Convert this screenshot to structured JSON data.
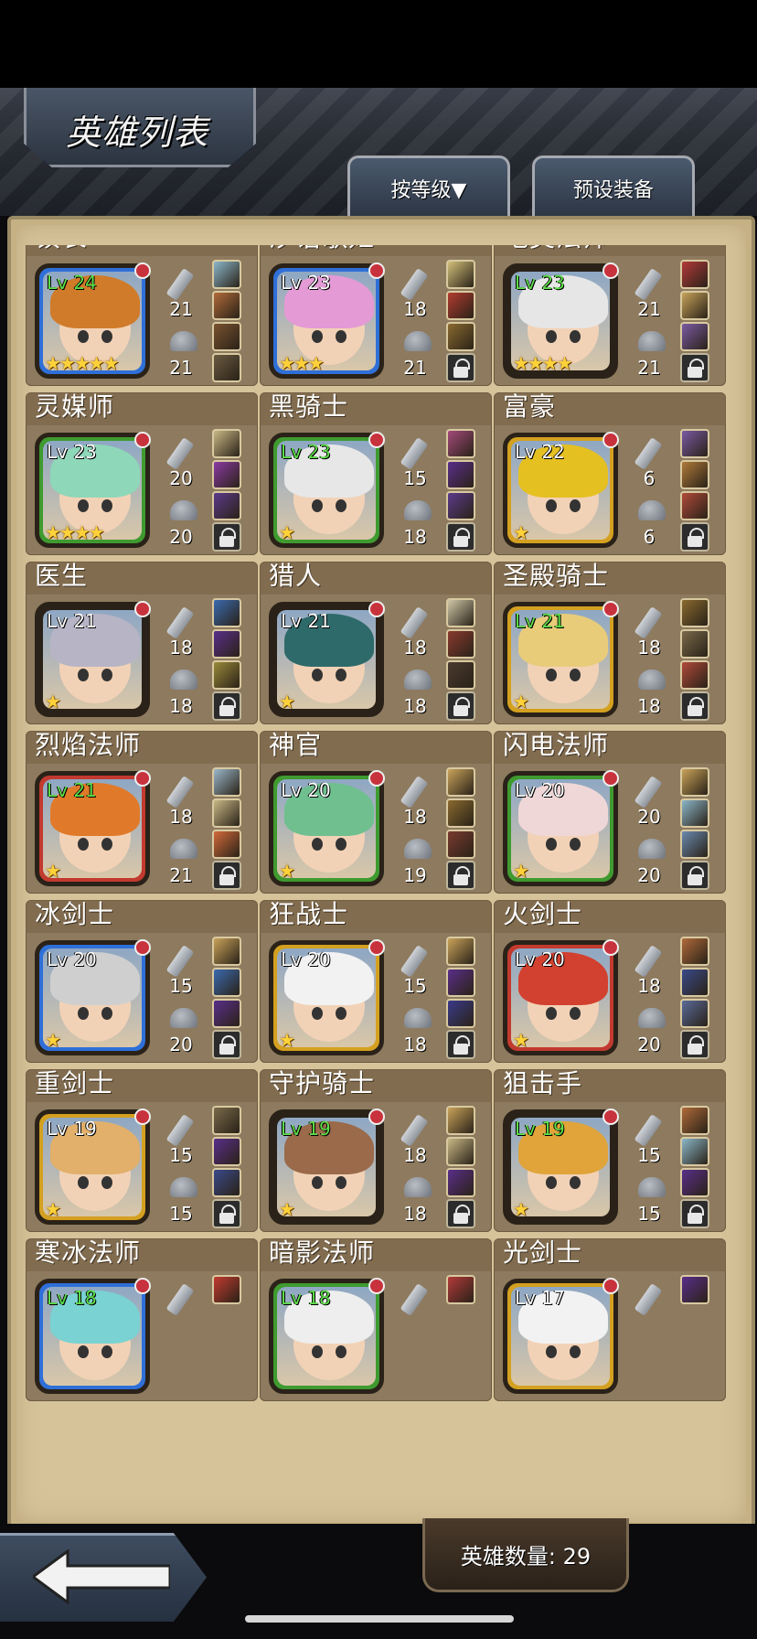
{
  "header": {
    "title": "英雄列表",
    "sort_label": "按等级▼",
    "preset_label": "预设装备"
  },
  "footer": {
    "hero_count": "英雄数量: 29"
  },
  "heroes": [
    {
      "name": "镇长",
      "lv": "Lv 24",
      "lv_green": true,
      "frame": "#2f6fd8",
      "hair": "#d07b2a",
      "stars": "★★★★★",
      "atk": "21",
      "def": "21",
      "slots": [
        "#8bb7c9",
        "#b06a3a",
        "#7a5230",
        "#6a5a40"
      ],
      "lock": false
    },
    {
      "name": "汐语歌姬",
      "lv": "Lv 23",
      "lv_green": false,
      "frame": "#2f6fd8",
      "hair": "#e39ad5",
      "stars": "★★★",
      "atk": "18",
      "def": "21",
      "slots": [
        "#d2c07a",
        "#b23b2f",
        "#8a6a2f"
      ],
      "lock": true
    },
    {
      "name": "地灵法师",
      "lv": "Lv 23",
      "lv_green": true,
      "frame": "#2a2218",
      "hair": "#e6e6e6",
      "stars": "★★★★",
      "atk": "21",
      "def": "21",
      "slots": [
        "#b33a3a",
        "#c7a35a",
        "#7a5aa3"
      ],
      "lock": true
    },
    {
      "name": "灵媒师",
      "lv": "Lv 23",
      "lv_green": false,
      "frame": "#3f9a2f",
      "hair": "#8ed7b9",
      "stars": "★★★★",
      "atk": "20",
      "def": "20",
      "slots": [
        "#c9b886",
        "#8a3aa3",
        "#5b3a8a"
      ],
      "lock": true
    },
    {
      "name": "黑骑士",
      "lv": "Lv 23",
      "lv_green": true,
      "frame": "#3f9a2f",
      "hair": "#e7e7e7",
      "stars": "★",
      "atk": "15",
      "def": "18",
      "slots": [
        "#a34a7a",
        "#5a2e8a",
        "#5b3a8a"
      ],
      "lock": true
    },
    {
      "name": "富豪",
      "lv": "Lv 22",
      "lv_green": false,
      "frame": "#d4a020",
      "hair": "#e5c021",
      "stars": "★",
      "atk": "6",
      "def": "6",
      "slots": [
        "#7a5aa3",
        "#b07a3a",
        "#b04a3a"
      ],
      "lock": true
    },
    {
      "name": "医生",
      "lv": "Lv 21",
      "lv_green": false,
      "frame": "#2a2218",
      "hair": "#b7b4c6",
      "stars": "★",
      "atk": "18",
      "def": "18",
      "slots": [
        "#3a6ab0",
        "#5a2e8a",
        "#9a8a3a"
      ],
      "lock": true
    },
    {
      "name": "猎人",
      "lv": "Lv 21",
      "lv_green": false,
      "frame": "#2a2218",
      "hair": "#2f6a6a",
      "stars": "★",
      "atk": "18",
      "def": "18",
      "slots": [
        "#d0c7a8",
        "#8a3a2f",
        "#4a3a2f"
      ],
      "lock": true
    },
    {
      "name": "圣殿骑士",
      "lv": "Lv 21",
      "lv_green": true,
      "frame": "#d4a020",
      "hair": "#e8cc7a",
      "stars": "★",
      "atk": "18",
      "def": "18",
      "slots": [
        "#8a6a2f",
        "#7a6a4a",
        "#b04a3a"
      ],
      "lock": true
    },
    {
      "name": "烈焰法师",
      "lv": "Lv 21",
      "lv_green": true,
      "frame": "#c23a2f",
      "hair": "#e07a2a",
      "stars": "★",
      "atk": "18",
      "def": "21",
      "slots": [
        "#9ab7c9",
        "#c9b886",
        "#d26a3a"
      ],
      "lock": true
    },
    {
      "name": "神官",
      "lv": "Lv 20",
      "lv_green": false,
      "frame": "#3f9a2f",
      "hair": "#6fbf8f",
      "stars": "★",
      "atk": "18",
      "def": "19",
      "slots": [
        "#c9a35a",
        "#8a6a2f",
        "#7a3a2f"
      ],
      "lock": true
    },
    {
      "name": "闪电法师",
      "lv": "Lv 20",
      "lv_green": false,
      "frame": "#3f9a2f",
      "hair": "#f0d7d7",
      "stars": "★",
      "atk": "20",
      "def": "20",
      "slots": [
        "#c9a35a",
        "#8bb7c9",
        "#6a8ab0"
      ],
      "lock": true
    },
    {
      "name": "冰剑士",
      "lv": "Lv 20",
      "lv_green": false,
      "frame": "#2f6fd8",
      "hair": "#cfcfcf",
      "stars": "★",
      "atk": "15",
      "def": "20",
      "slots": [
        "#c9a35a",
        "#3a6ab0",
        "#5a2e8a"
      ],
      "lock": true
    },
    {
      "name": "狂战士",
      "lv": "Lv 20",
      "lv_green": false,
      "frame": "#d4a020",
      "hair": "#f2f2f2",
      "stars": "★",
      "atk": "15",
      "def": "18",
      "slots": [
        "#c9a35a",
        "#5a2e8a",
        "#3a3a8a"
      ],
      "lock": true
    },
    {
      "name": "火剑士",
      "lv": "Lv 20",
      "lv_green": false,
      "frame": "#c23a2f",
      "hair": "#d2402f",
      "stars": "★",
      "atk": "18",
      "def": "20",
      "slots": [
        "#b06a3a",
        "#3a4a8a",
        "#5a6a9a"
      ],
      "lock": true
    },
    {
      "name": "重剑士",
      "lv": "Lv 19",
      "lv_green": false,
      "frame": "#d4a020",
      "hair": "#e2b06a",
      "stars": "★",
      "atk": "15",
      "def": "15",
      "slots": [
        "#7a6a4a",
        "#5a2e8a",
        "#3a4a8a"
      ],
      "lock": true
    },
    {
      "name": "守护骑士",
      "lv": "Lv 19",
      "lv_green": true,
      "frame": "#2a2218",
      "hair": "#9a6a4a",
      "stars": "★",
      "atk": "18",
      "def": "18",
      "slots": [
        "#c9a35a",
        "#c9b886",
        "#5a2e8a"
      ],
      "lock": true
    },
    {
      "name": "狙击手",
      "lv": "Lv 19",
      "lv_green": true,
      "frame": "#2a2218",
      "hair": "#e0a43a",
      "stars": "★",
      "atk": "15",
      "def": "15",
      "slots": [
        "#b06a3a",
        "#8bb7c9",
        "#5a2e8a"
      ],
      "lock": true
    },
    {
      "name": "寒冰法师",
      "lv": "Lv 18",
      "lv_green": true,
      "frame": "#2f6fd8",
      "hair": "#7ad2d2",
      "stars": "",
      "atk": "",
      "def": "",
      "slots": [
        "#c23a2f"
      ],
      "lock": false
    },
    {
      "name": "暗影法师",
      "lv": "Lv 18",
      "lv_green": true,
      "frame": "#3f9a2f",
      "hair": "#eeeeee",
      "stars": "",
      "atk": "",
      "def": "",
      "slots": [
        "#b33a3a"
      ],
      "lock": false
    },
    {
      "name": "光剑士",
      "lv": "Lv 17",
      "lv_green": false,
      "frame": "#d4a020",
      "hair": "#f2f2f2",
      "stars": "",
      "atk": "",
      "def": "",
      "slots": [
        "#5a2e8a"
      ],
      "lock": false
    }
  ]
}
